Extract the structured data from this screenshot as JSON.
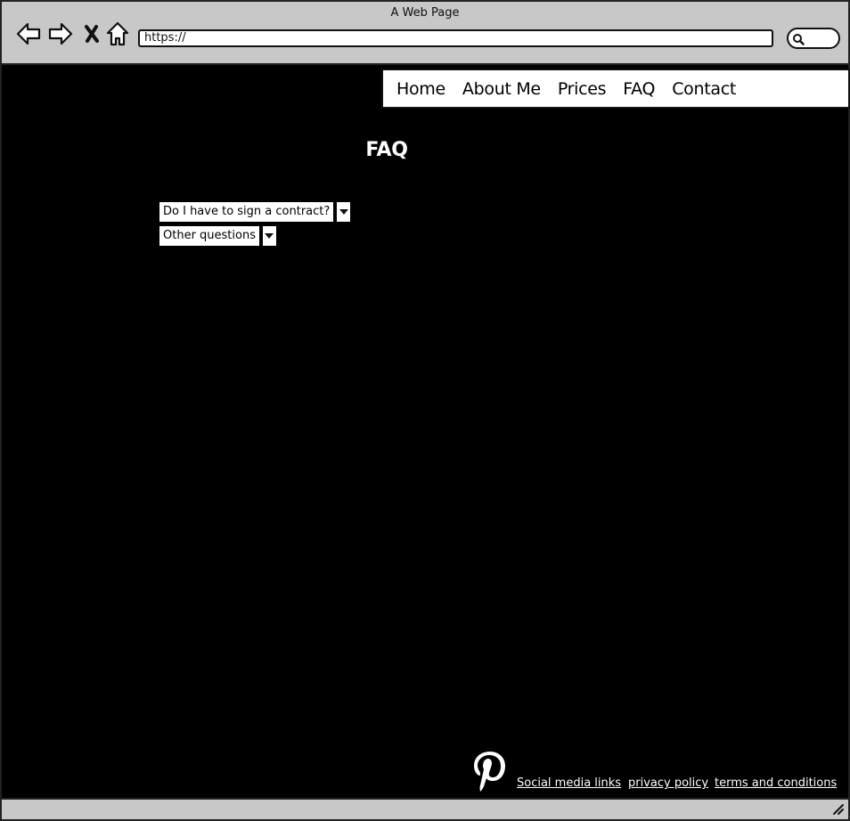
{
  "window": {
    "title": "A Web Page",
    "url": "https://"
  },
  "icons": {
    "back": "back-arrow-icon",
    "forward": "forward-arrow-icon",
    "stop": "close-icon",
    "home": "home-icon",
    "search": "search-icon",
    "pinterest": "pinterest-icon",
    "resize": "resize-grip-icon"
  },
  "nav": {
    "items": [
      "Home",
      "About Me",
      "Prices",
      "FAQ",
      "Contact"
    ]
  },
  "main": {
    "title": "FAQ",
    "faq": [
      {
        "label": "Do I have to sign a contract?"
      },
      {
        "label": "Other questions"
      }
    ]
  },
  "footer": {
    "links": [
      "Social media links",
      "privacy policy",
      "terms and conditions"
    ]
  },
  "colors": {
    "page_background": "#000000",
    "chrome": "#c8c8c8",
    "text_on_dark": "#ffffff"
  }
}
